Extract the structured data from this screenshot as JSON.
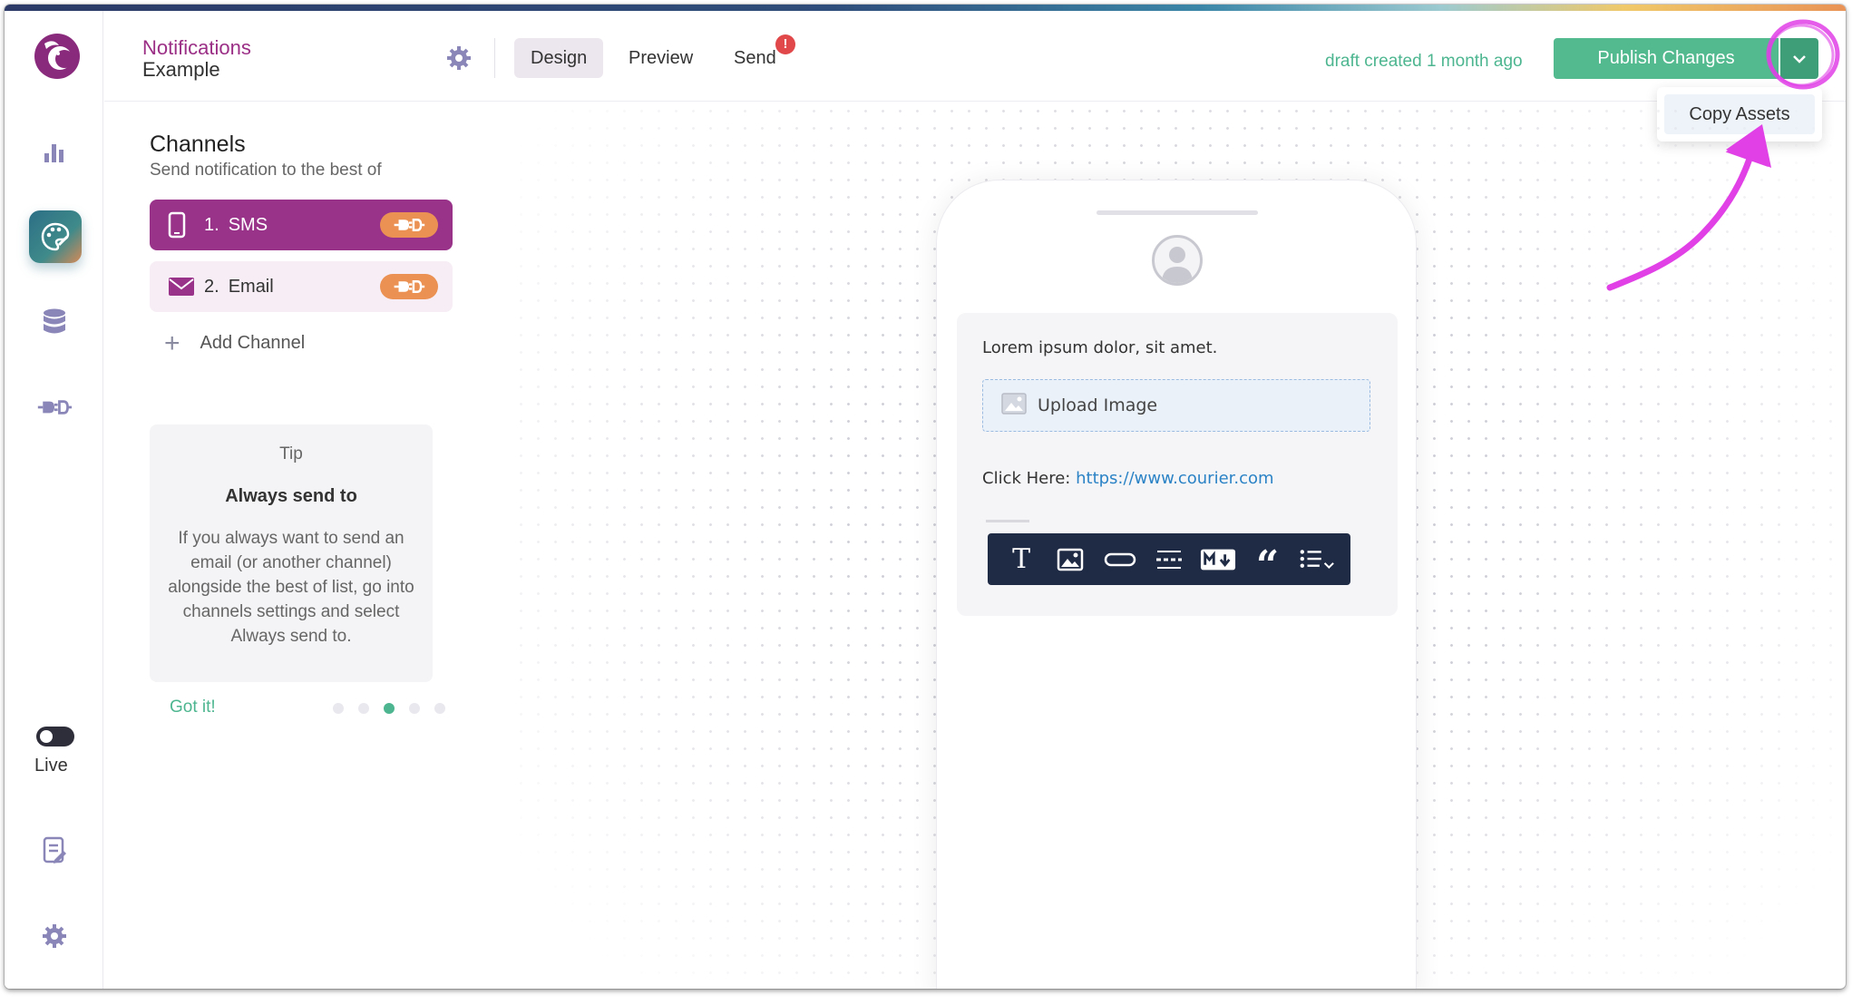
{
  "header": {
    "title_line1": "Notifications",
    "title_line2": "Example",
    "tabs": [
      {
        "label": "Design",
        "active": true
      },
      {
        "label": "Preview",
        "active": false
      },
      {
        "label": "Send",
        "active": false
      }
    ],
    "send_alert": "!",
    "draft_status": "draft created 1 month ago",
    "publish_label": "Publish Changes",
    "dropdown_menu": {
      "items": [
        {
          "label": "Copy Assets"
        }
      ]
    }
  },
  "sidebar": {
    "items": [
      {
        "name": "analytics",
        "icon": "bar-chart-icon"
      },
      {
        "name": "designer",
        "icon": "palette-icon",
        "active": true
      },
      {
        "name": "data",
        "icon": "database-icon"
      },
      {
        "name": "integrations",
        "icon": "plug-icon"
      }
    ],
    "live_label": "Live",
    "bottom_icons": [
      "document-icon",
      "gear-icon"
    ]
  },
  "channels": {
    "title": "Channels",
    "subtitle": "Send notification to the best of",
    "items": [
      {
        "number": "1.",
        "label": "SMS",
        "icon": "phone-icon",
        "active": true
      },
      {
        "number": "2.",
        "label": "Email",
        "icon": "envelope-icon",
        "active": false
      }
    ],
    "add_label": "Add Channel"
  },
  "tip": {
    "label": "Tip",
    "heading": "Always send to",
    "body": "If you always want to send an email (or another channel) alongside the best of list, go into channels settings and select Always send to.",
    "got_it": "Got it!",
    "page_count": 5,
    "active_page": 3
  },
  "preview": {
    "message": "Lorem ipsum dolor, sit amet.",
    "upload_label": "Upload Image",
    "click_label": "Click Here:",
    "link": "https://www.courier.com",
    "toolbar": [
      "text-icon",
      "image-icon",
      "button-icon",
      "divider-icon",
      "markdown-icon",
      "quote-icon",
      "list-icon"
    ]
  },
  "colors": {
    "brand_purple": "#99338a",
    "publish_green": "#53b98f",
    "plug_orange": "#eb9153",
    "annotation_magenta": "#e040e6"
  }
}
